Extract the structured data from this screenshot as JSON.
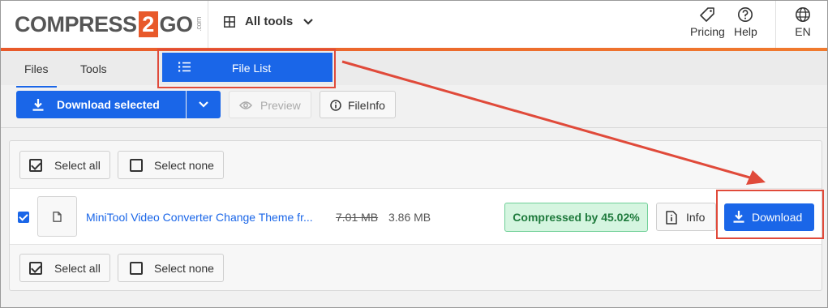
{
  "header": {
    "logo_left": "COMPRESS",
    "logo_num": "2",
    "logo_right": "GO",
    "logo_suffix": ".com",
    "all_tools_label": "All tools",
    "pricing_label": "Pricing",
    "help_label": "Help",
    "language_label": "EN"
  },
  "tabs": {
    "files_label": "Files",
    "tools_label": "Tools",
    "file_list_label": "File List"
  },
  "toolbar": {
    "download_selected_label": "Download selected",
    "preview_label": "Preview",
    "fileinfo_label": "FileInfo"
  },
  "selection": {
    "select_all_label": "Select all",
    "select_none_label": "Select none"
  },
  "file": {
    "name": "MiniTool Video Converter Change Theme fr...",
    "original_size": "7.01 MB",
    "compressed_size": "3.86 MB",
    "status": "Compressed by 45.02%",
    "info_label": "Info",
    "download_label": "Download"
  },
  "colors": {
    "accent": "#1a66e8",
    "brand": "#e8592a",
    "annotation": "#e04a3a",
    "success_bg": "#d5f5e0"
  }
}
